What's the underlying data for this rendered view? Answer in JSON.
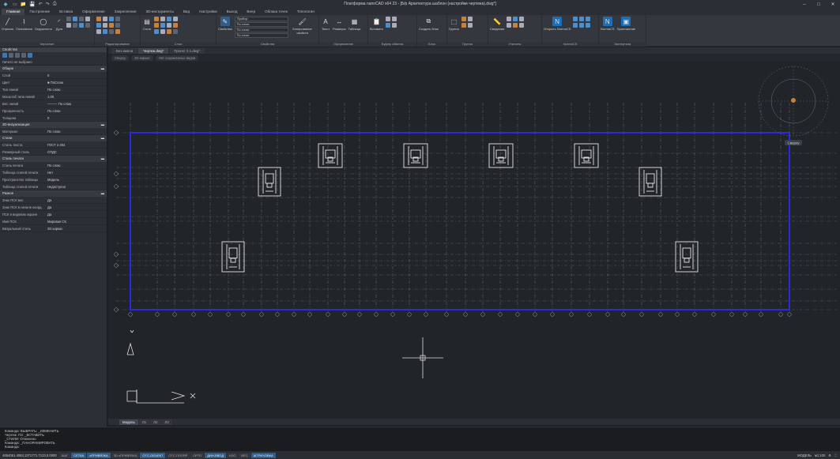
{
  "window": {
    "title": "Платформа nanoCAD x64 23 - [Б/р Архитектура шаблон (настройки чертежа).dwg*]",
    "controls": [
      "–",
      "□",
      "✕"
    ]
  },
  "quick_access": [
    "▭",
    "📁",
    "💾",
    "↶",
    "↷",
    "⎙"
  ],
  "menu": [
    "Главная",
    "Построение",
    "Вставка",
    "Оформление",
    "Закрепление",
    "3D-инструменты",
    "Вид",
    "Настройки",
    "Выход",
    "Веер",
    "Облака точек",
    "Топология"
  ],
  "ribbon": {
    "groups": [
      {
        "label": "Черчение",
        "buttons": [
          "Отрезок",
          "Полилиния",
          "Окружность",
          "Дуга"
        ]
      },
      {
        "label": "Редактирование",
        "buttons": []
      },
      {
        "label": "Слои",
        "buttons": [
          "Слои"
        ]
      },
      {
        "label": "Свойства",
        "buttons": [
          "Свойства"
        ],
        "dropdowns": [
          "Прибор",
          "По слою",
          "По слою",
          "По слою"
        ],
        "extra": "Копирование свойств"
      },
      {
        "label": "Оформление",
        "buttons": [
          "Текст",
          "Размеры",
          "Таблица"
        ]
      },
      {
        "label": "Буфер обмена",
        "buttons": [
          "Вставить"
        ]
      },
      {
        "label": "Блок",
        "buttons": [
          "Создать блок"
        ]
      },
      {
        "label": "Группа",
        "buttons": [
          "Группа"
        ]
      },
      {
        "label": "Утилиты",
        "buttons": [
          "Сведения"
        ]
      },
      {
        "label": "NormaCS",
        "buttons": [
          "Открыть NormaCS"
        ]
      },
      {
        "label": "Экспертиза",
        "buttons": [
          "NormaCS",
          "Приложение"
        ]
      }
    ]
  },
  "properties_panel": {
    "title": "Свойства",
    "selection": "Ничего не выбрано",
    "sections": [
      {
        "name": "Общие",
        "rows": [
          {
            "k": "Слой",
            "v": "0"
          },
          {
            "k": "Цвет",
            "v": "■ ПоСлою"
          },
          {
            "k": "Тип линий",
            "v": "По слою"
          },
          {
            "k": "Масштаб типа линий",
            "v": "1.00"
          },
          {
            "k": "Вес линий",
            "v": "——— По слою"
          },
          {
            "k": "Прозрачность",
            "v": "По слою"
          },
          {
            "k": "Толщина",
            "v": "0"
          }
        ]
      },
      {
        "name": "3D-визуализация",
        "rows": [
          {
            "k": "Материал",
            "v": "По слою"
          }
        ]
      },
      {
        "name": "Стили",
        "rows": [
          {
            "k": "Стиль текста",
            "v": "ГОСТ 2.304"
          },
          {
            "k": "Размерный стиль",
            "v": "СПДС"
          }
        ]
      },
      {
        "name": "Стиль печати",
        "rows": [
          {
            "k": "Стиль печати",
            "v": "По слою"
          },
          {
            "k": "Таблица стилей печати",
            "v": "Нет"
          },
          {
            "k": "Пространство таблицы",
            "v": "Модель"
          },
          {
            "k": "Таблица стилей печати",
            "v": "Недоступно"
          }
        ]
      },
      {
        "name": "Разное",
        "rows": [
          {
            "k": "Знак ПСК вкл.",
            "v": "Да"
          },
          {
            "k": "Знак ПСК в начале коорд.",
            "v": "Да"
          },
          {
            "k": "ПСК в видовом экране",
            "v": "Да"
          },
          {
            "k": "Имя ПСК",
            "v": "Мировая СК"
          },
          {
            "k": "Визуальный стиль",
            "v": "2D каркас"
          }
        ]
      }
    ]
  },
  "doc_tabs": [
    "Без имени",
    "Чертеж.dwg*",
    "Проект 2.1.dwg*"
  ],
  "active_doc_tab": 1,
  "breadcrumb": [
    "Сверху",
    "2D-каркас",
    "Нет сохранённых видов"
  ],
  "viewcube_label": "Сверху",
  "layout_tabs": [
    "Модель",
    "Л1",
    "Л2",
    "Л3"
  ],
  "command_line": [
    "Команда: ВЫБРАТЬ: _ИЗМЕНИТЬ",
    "Чертеж: ПЗ: _ВСТАВИТЬ",
    "_СТИЛИ: Отменено",
    "Команда: _ПАНОРАМИРОВАТЬ",
    "Команда:"
  ],
  "statusbar": {
    "coords": "4654051.4063,1371771.7123,0.0000",
    "toggles": [
      {
        "t": "ШАГ",
        "on": false
      },
      {
        "t": "СЕТКА",
        "on": true
      },
      {
        "t": "оПРИВЯЗКА",
        "on": true
      },
      {
        "t": "3D оПРИВЯЗКА",
        "on": false
      },
      {
        "t": "ОТС-ОБЪЕКТ",
        "on": true
      },
      {
        "t": "ОТС-ПОЛЯР",
        "on": false
      },
      {
        "t": "ОРТО",
        "on": false
      },
      {
        "t": "ДИН-ВВОД",
        "on": true
      },
      {
        "t": "ИЗО",
        "on": false
      },
      {
        "t": "ВЕС",
        "on": false
      },
      {
        "t": "ШТРИХОВКА",
        "on": true
      }
    ],
    "space": "МОДЕЛЬ",
    "scale": "м1:100"
  },
  "colors": {
    "frame": "#2a2ae0",
    "gridline": "#5b6068",
    "crosshair": "#dddddd",
    "accent": "#2f5d8c"
  }
}
